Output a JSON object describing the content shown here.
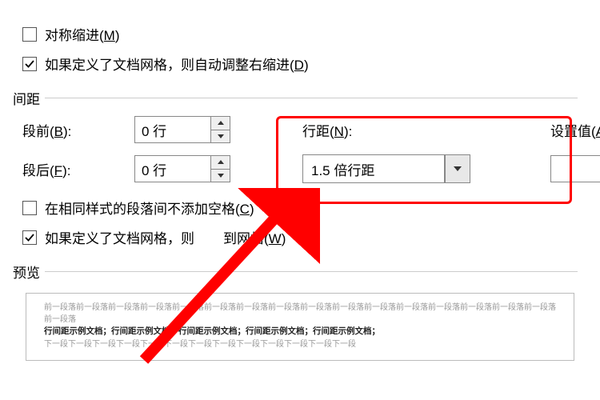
{
  "checkboxes": {
    "mirror": {
      "label_pre": "对称缩进(",
      "mn": "M",
      "label_post": ")",
      "checked": false
    },
    "auto_right": {
      "label_pre": "如果定义了文档网格，则自动调整右缩进(",
      "mn": "D",
      "label_post": ")",
      "checked": true
    },
    "no_space": {
      "label_pre": "在相同样式的段落间不添加空格(",
      "mn": "C",
      "label_post": ")",
      "checked": false
    },
    "snap": {
      "label_pre": "如果定义了文档网格，则",
      "gap": "到网格(",
      "mn": "W",
      "label_post": ")",
      "checked": true
    }
  },
  "sections": {
    "spacing": "间距",
    "preview": "预览"
  },
  "labels": {
    "before": {
      "pre": "段前(",
      "mn": "B",
      "post": "):"
    },
    "after": {
      "pre": "段后(",
      "mn": "F",
      "post": "):"
    },
    "linespace": {
      "pre": "行距(",
      "mn": "N",
      "post": "):"
    },
    "setval": {
      "pre": "设置值(",
      "mn": "A",
      "post": "):"
    }
  },
  "values": {
    "before": "0 行",
    "after": "0 行",
    "linespace": "1.5 倍行距",
    "setval": ""
  },
  "preview": {
    "g1": "前一段落前一段落前一段落前一段落前一段落前一段落前一段落前一段落前一段落前一段落前一段落前一段落前一段落前一段落前一段落前一段落前一段落",
    "bold": "行间距示例文档；行间距示例文档；行间距示例文档；行间距示例文档；行间距示例文档；",
    "g2": "下一段下一段下一段下一段下一段下一段下一段下一段下一段下一段下一段下一段下一段"
  }
}
